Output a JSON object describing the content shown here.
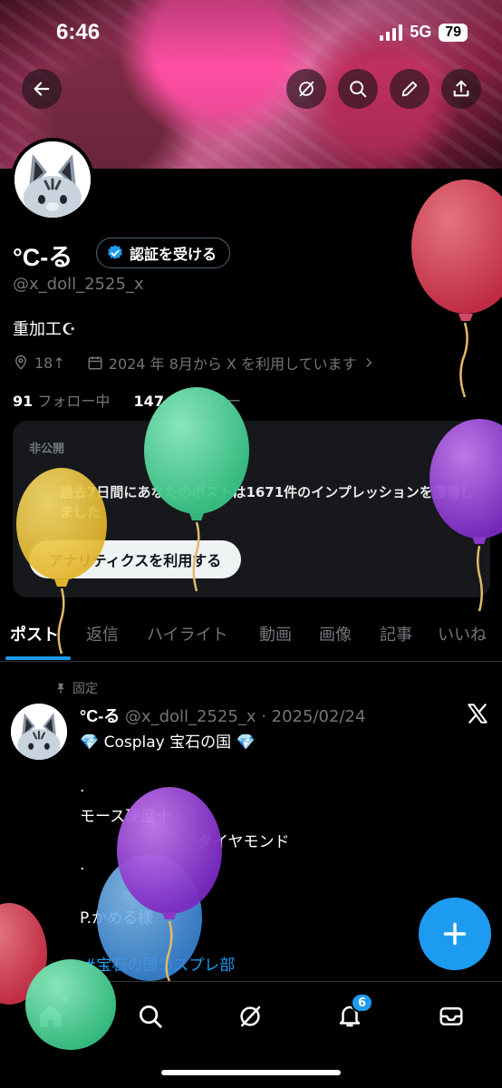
{
  "status_bar": {
    "time": "6:46",
    "network": "5G",
    "battery": "79"
  },
  "header": {
    "back_icon": "arrow-left-icon",
    "grok_icon": "grok-slash-icon",
    "search_icon": "search-icon",
    "edit_icon": "pencil-icon",
    "share_icon": "share-icon"
  },
  "profile": {
    "display_name": "°C-る",
    "verify_button": "認証を受ける",
    "handle": "@x_doll_2525_x",
    "bio": "重加工☪︎",
    "location": "18↑",
    "joined": "2024 年 8月から X を利用しています",
    "following_count": "91",
    "following_label": " フォロー中",
    "followers_count": "147",
    "followers_label": " フォロワー"
  },
  "analytics_card": {
    "label": "非公開",
    "text": "過去7日間にあなたのポストは1671件のインプレッションを獲得しました",
    "cta": "アナリティクスを利用する"
  },
  "tabs": [
    "ポスト",
    "返信",
    "ハイライト",
    "動画",
    "画像",
    "記事",
    "いいね"
  ],
  "post": {
    "pinned_label": "固定",
    "author_name": "°C-る",
    "author_meta": " @x_doll_2525_x · 2025/02/24",
    "line1": "💎  Cosplay 宝石の国  💎",
    "line2": ".",
    "line3": "モース硬度十",
    "line4": "ダイヤモンド",
    "line5": ".",
    "line6": "P.かめる様",
    "hashtag": "#宝石の国コスプレ部"
  },
  "bottom_nav": {
    "items": [
      "home-icon",
      "search-icon",
      "grok-icon",
      "notifications-icon",
      "messages-icon"
    ],
    "notifications_badge": "6"
  },
  "colors": {
    "accent": "#1d9bf0",
    "background": "#000000",
    "muted": "#71767b"
  }
}
